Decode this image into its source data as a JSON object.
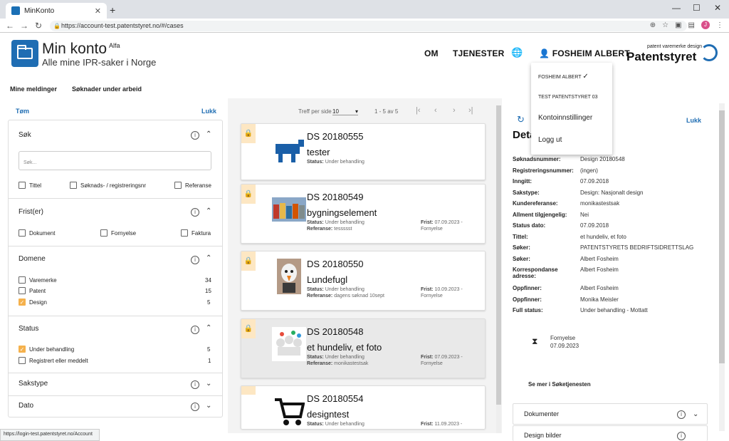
{
  "browser": {
    "tab_title": "MinKonto",
    "url": "https://account-test.patentstyret.no/#/cases",
    "status_url": "https://login-test.patentstyret.no/Account",
    "profile_initial": "J"
  },
  "header": {
    "title": "Min konto",
    "title_sup": "Alfa",
    "subtitle": "Alle mine IPR-saker i Norge",
    "nav_om": "OM",
    "nav_tjenester": "TJENESTER",
    "user_name": "FOSHEIM ALBERT",
    "logo_small": "patent varemerke design",
    "logo_big": "Patentstyret"
  },
  "subnav": {
    "messages": "Mine meldinger",
    "drafts": "Søknader under arbeid"
  },
  "filters": {
    "clear": "Tøm",
    "close": "Lukk",
    "sok": {
      "title": "Søk",
      "placeholder": "Søk...",
      "opts": [
        "Tittel",
        "Søknads- / registreringsnr",
        "Referanse"
      ]
    },
    "frister": {
      "title": "Frist(er)",
      "opts": [
        "Dokument",
        "Fornyelse",
        "Faktura"
      ]
    },
    "domene": {
      "title": "Domene",
      "items": [
        {
          "label": "Varemerke",
          "count": "34",
          "checked": false
        },
        {
          "label": "Patent",
          "count": "15",
          "checked": false
        },
        {
          "label": "Design",
          "count": "5",
          "checked": true
        }
      ]
    },
    "status": {
      "title": "Status",
      "items": [
        {
          "label": "Under behandling",
          "count": "5",
          "checked": true
        },
        {
          "label": "Registrert eller meddelt",
          "count": "1",
          "checked": false
        }
      ]
    },
    "sakstype": {
      "title": "Sakstype"
    },
    "dato": {
      "title": "Dato"
    }
  },
  "pager": {
    "per_page_label": "Treff per side",
    "per_page": "10",
    "range": "1 - 5 av 5"
  },
  "cases": [
    {
      "id": "DS 20180555",
      "name": "tester",
      "status_label": "Status:",
      "status": "Under behandling"
    },
    {
      "id": "DS 20180549",
      "name": "bygningselement",
      "status_label": "Status:",
      "status": "Under behandling",
      "ref_label": "Referanse:",
      "ref": "tessssst",
      "frist_label": "Frist:",
      "frist": "07.09.2023 -",
      "frist_type": "Fornyelse"
    },
    {
      "id": "DS 20180550",
      "name": "Lundefugl",
      "status_label": "Status:",
      "status": "Under behandling",
      "ref_label": "Referanse:",
      "ref": "dagens søknad 10sept",
      "frist_label": "Frist:",
      "frist": "10.09.2023 -",
      "frist_type": "Fornyelse"
    },
    {
      "id": "DS 20180548",
      "name": "et hundeliv, et foto",
      "status_label": "Status:",
      "status": "Under behandling",
      "ref_label": "Referanse:",
      "ref": "monikastestsak",
      "frist_label": "Frist:",
      "frist": "07.09.2023 -",
      "frist_type": "Fornyelse"
    },
    {
      "id": "DS 20180554",
      "name": "designtest",
      "status_label": "Status:",
      "status": "Under behandling",
      "frist_label": "Frist:",
      "frist": "11.09.2023 -"
    }
  ],
  "detail": {
    "title": "Deta",
    "close": "Lukk",
    "rows": [
      {
        "k": "Søknadsnummer:",
        "v": "Design 20180548"
      },
      {
        "k": "Registreringsnummer:",
        "v": "(ingen)"
      },
      {
        "k": "Inngitt:",
        "v": "07.09.2018"
      },
      {
        "k": "Sakstype:",
        "v": "Design: Nasjonalt design"
      },
      {
        "k": "Kundereferanse:",
        "v": "monikastestsak"
      },
      {
        "k": "Allment tilgjengelig:",
        "v": "Nei"
      },
      {
        "k": "Status dato:",
        "v": "07.09.2018"
      },
      {
        "k": "Tittel:",
        "v": "et hundeliv, et foto"
      },
      {
        "k": "Søker:",
        "v": "PATENTSTYRETS BEDRIFTSIDRETTSLAG"
      },
      {
        "k": "Søker:",
        "v": "Albert Fosheim"
      },
      {
        "k": "Korrespondanse adresse:",
        "v": "Albert Fosheim"
      },
      {
        "k": "Oppfinner:",
        "v": "Albert Fosheim"
      },
      {
        "k": "Oppfinner:",
        "v": "Monika Meisler"
      },
      {
        "k": "Full status:",
        "v": "Under behandling   - Mottatt"
      }
    ],
    "deadline_type": "Fornyelse",
    "deadline_date": "07.09.2023",
    "more_link": "Se mer i Søketjenesten",
    "acc_docs": "Dokumenter",
    "acc_images": "Design bilder"
  },
  "dropdown": {
    "account1": "FOSHEIM ALBERT",
    "account2": "TEST PATENTSTYRET 03",
    "settings": "Kontoinnstillinger",
    "logout": "Logg ut"
  },
  "colors": {
    "accent": "#1f6db3",
    "checkbox": "#f5b14c",
    "lock_badge": "#fde7c3"
  }
}
